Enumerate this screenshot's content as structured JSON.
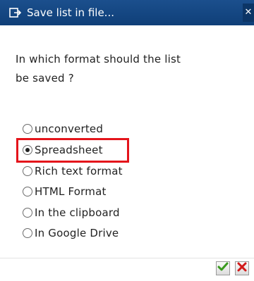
{
  "window": {
    "title": "Save list in file...",
    "close_symbol": "✕"
  },
  "question": {
    "line1": "In which format should the list",
    "line2": "be saved ?"
  },
  "options": [
    {
      "label": "unconverted",
      "selected": false
    },
    {
      "label": "Spreadsheet",
      "selected": true
    },
    {
      "label": "Rich text format",
      "selected": false
    },
    {
      "label": "HTML Format",
      "selected": false
    },
    {
      "label": "In the clipboard",
      "selected": false
    },
    {
      "label": "In Google Drive",
      "selected": false
    }
  ],
  "buttons": {
    "confirm_icon": "checkmark-icon",
    "cancel_icon": "cancel-x-icon"
  },
  "colors": {
    "titlebar": "#1b4f8d",
    "highlight": "#e4141b",
    "confirm": "#3a9a1f",
    "cancel": "#d11a1a"
  }
}
